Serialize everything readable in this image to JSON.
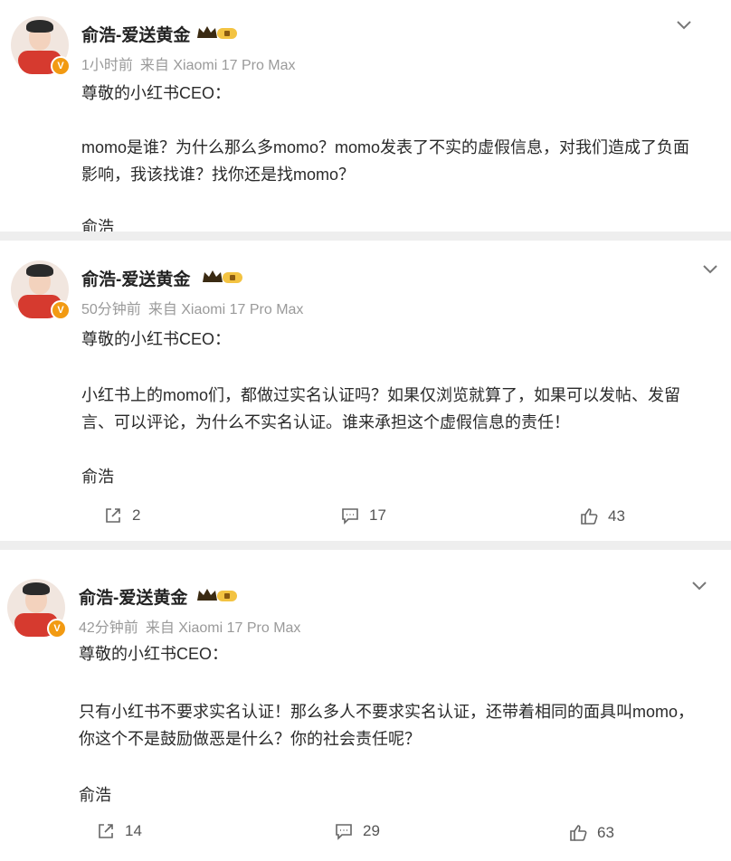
{
  "posts": [
    {
      "author": "俞浩-爱送黄金",
      "time": "1小时前",
      "source": "来自 Xiaomi 17 Pro Max",
      "paragraphs": [
        "尊敬的小红书CEO：",
        "momo是谁？为什么那么多momo？momo发表了不实的虚假信息，对我们造成了负面影响，我该找谁？找你还是找momo？"
      ],
      "signature_partial": "俞浩"
    },
    {
      "author": "俞浩-爱送黄金",
      "time": "50分钟前",
      "source": "来自 Xiaomi 17 Pro Max",
      "paragraphs": [
        "尊敬的小红书CEO：",
        "小红书上的momo们，都做过实名认证吗？如果仅浏览就算了，如果可以发帖、发留言、可以评论，为什么不实名认证。谁来承担这个虚假信息的责任！",
        "俞浩"
      ],
      "reposts": "2",
      "comments": "17",
      "likes": "43"
    },
    {
      "author": "俞浩-爱送黄金",
      "time": "42分钟前",
      "source": "来自 Xiaomi 17 Pro Max",
      "paragraphs": [
        "尊敬的小红书CEO：",
        "只有小红书不要求实名认证！那么多人不要求实名认证，还带着相同的面具叫momo，你这个不是鼓励做恶是什么？你的社会责任呢？",
        "俞浩"
      ],
      "reposts": "14",
      "comments": "29",
      "likes": "63"
    }
  ],
  "icons": {
    "avatar_badge": "verified-v-icon",
    "crown": "vip-crown-icon",
    "menu": "chevron-down-icon",
    "repost": "repost-icon",
    "comment": "comment-icon",
    "like": "thumbs-up-icon"
  },
  "colors": {
    "background": "#eeeeee",
    "card": "#ffffff",
    "meta": "#9a9a9a",
    "badge": "#f29a12",
    "avatar_shirt": "#d63a2f"
  }
}
